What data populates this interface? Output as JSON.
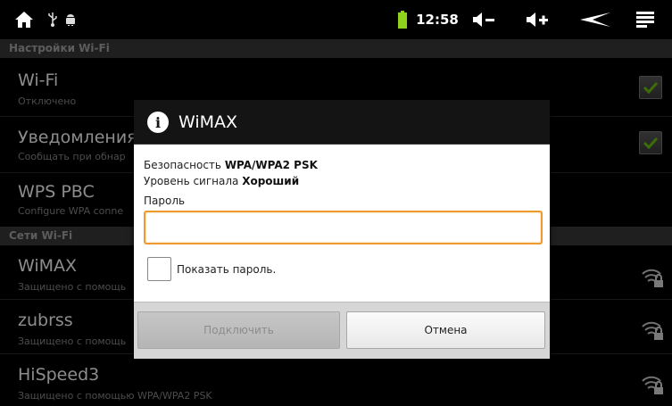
{
  "status_bar": {
    "clock": "12:58",
    "icons": [
      "home-icon",
      "usb-icon",
      "android-debug-icon",
      "battery-icon",
      "volume-down-icon",
      "volume-up-icon",
      "back-icon",
      "menu-icon"
    ]
  },
  "wifi_settings": {
    "header": "Настройки Wi-Fi",
    "items": [
      {
        "title": "Wi-Fi",
        "subtitle": "Отключено",
        "checked": true
      },
      {
        "title": "Уведомления",
        "subtitle": "Сообщать при обнар",
        "checked": true
      },
      {
        "title": "WPS PBC",
        "subtitle": "Configure WPA conne"
      }
    ]
  },
  "networks": {
    "header": "Сети Wi-Fi",
    "items": [
      {
        "title": "WiMAX",
        "subtitle": "Защищено с помощь",
        "icon": "wifi-lock-icon"
      },
      {
        "title": "zubrss",
        "subtitle": "Защищено с помощь",
        "icon": "wifi-lock-icon"
      },
      {
        "title": "HiSpeed3",
        "subtitle": "Защищено с помощью WPA/WPA2 PSK",
        "icon": "wifi-lock-icon"
      }
    ]
  },
  "dialog": {
    "title": "WiMAX",
    "security_label": "Безопасность",
    "security_value": "WPA/WPA2 PSK",
    "signal_label": "Уровень сигнала",
    "signal_value": "Хороший",
    "password_label": "Пароль",
    "password_value": "",
    "show_password_label": "Показать пароль.",
    "show_password_checked": false,
    "connect_label": "Подключить",
    "cancel_label": "Отмена",
    "accent_color": "#ee9a2e"
  }
}
